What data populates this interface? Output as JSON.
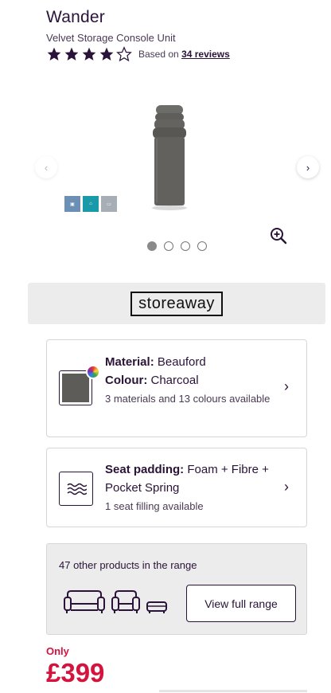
{
  "product": {
    "name": "Wander",
    "subtitle": "Velvet Storage Console Unit",
    "rating": 4,
    "rating_max": 5,
    "reviews_prefix": "Based on",
    "reviews_link": "34 reviews"
  },
  "gallery": {
    "prev_label": "‹",
    "next_label": "›",
    "badges": [
      {
        "icon": "feature-badge-icon",
        "color": "#6b8fb5"
      },
      {
        "icon": "feature-badge-icon",
        "color": "#1a9aa8"
      },
      {
        "icon": "feature-badge-icon",
        "color": "#a8aeb5"
      }
    ],
    "active_slide": 1,
    "total_slides": 4
  },
  "brand": {
    "logo_text": "storeaway"
  },
  "material_card": {
    "material_label": "Material:",
    "material_value": "Beauford",
    "colour_label": "Colour:",
    "colour_value": "Charcoal",
    "availability": "3 materials and 13 colours available",
    "swatch_color": "#5e5c58",
    "chevron": "›"
  },
  "padding_card": {
    "label": "Seat padding:",
    "value": "Foam + Fibre + Pocket Spring",
    "availability": "1 seat filling available",
    "chevron": "›"
  },
  "range": {
    "text": "47 other products in the range",
    "button_label": "View full range"
  },
  "price": {
    "only_label": "Only",
    "amount": "£399"
  },
  "colors": {
    "brand_purple": "#2a1338",
    "price_red": "#d4143d"
  }
}
